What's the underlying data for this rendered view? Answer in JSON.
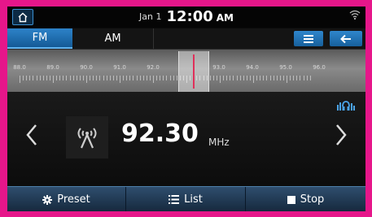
{
  "status": {
    "date": "Jan 1",
    "time": "12:00",
    "ampm": "AM"
  },
  "tabs": [
    {
      "label": "FM",
      "active": true
    },
    {
      "label": "AM",
      "active": false
    }
  ],
  "tuner": {
    "scale_labels": [
      "88.0",
      "89.0",
      "90.0",
      "91.0",
      "92.0",
      "93.0",
      "94.0",
      "95.0",
      "96.0"
    ]
  },
  "station": {
    "frequency": "92.30",
    "unit": "MHz"
  },
  "bottom_bar": {
    "preset_label": "Preset",
    "list_label": "List",
    "stop_label": "Stop"
  },
  "icons": [
    "home-icon",
    "wifi-icon",
    "menu-icon",
    "back-arrow-icon",
    "signal-icon",
    "antenna-icon",
    "chevron-left-icon",
    "chevron-right-icon",
    "gear-icon",
    "list-icon",
    "stop-icon"
  ],
  "colors": {
    "frame": "#e6168a",
    "accent": "#2d83c9",
    "needle": "#e0305a",
    "background": "#0a0a0a"
  }
}
